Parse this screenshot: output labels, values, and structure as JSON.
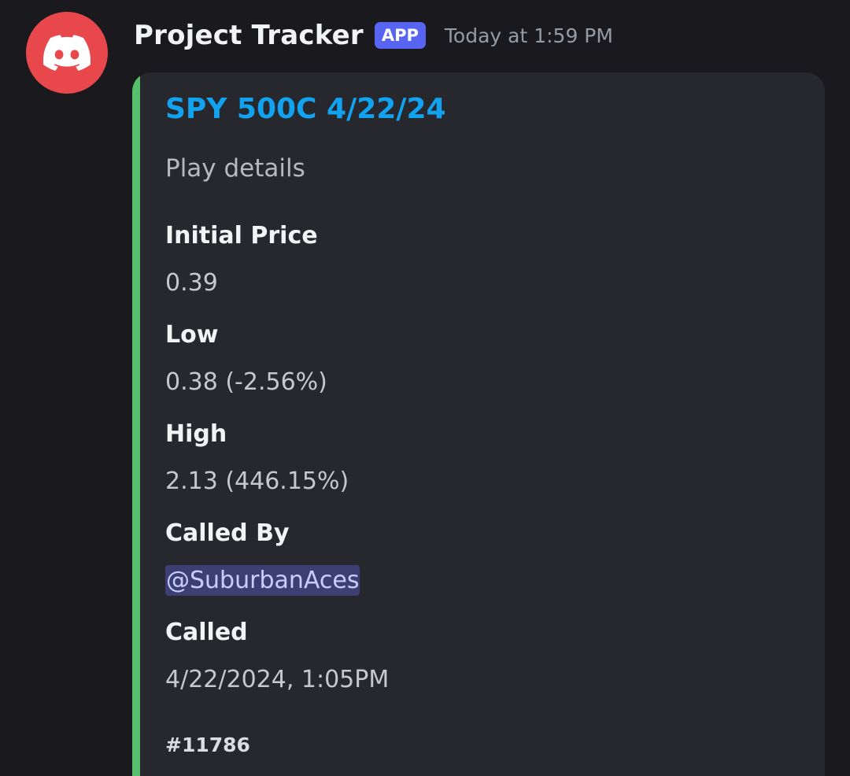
{
  "message": {
    "author": "Project Tracker",
    "badge": "APP",
    "timestamp": "Today at 1:59 PM",
    "avatar_icon": "discord-logo-icon",
    "colors": {
      "avatar_bg": "#e8474b",
      "badge_bg": "#5865f2",
      "embed_accent": "#57bf6b",
      "title": "#11a2f0",
      "mention_bg": "#3c3f74"
    }
  },
  "embed": {
    "title": "SPY 500C 4/22/24",
    "description": "Play details",
    "fields": [
      {
        "name": "Initial Price",
        "value": "0.39"
      },
      {
        "name": "Low",
        "value": "0.38 (-2.56%)"
      },
      {
        "name": "High",
        "value": "2.13 (446.15%)"
      },
      {
        "name": "Called By",
        "value": "@SuburbanAces"
      },
      {
        "name": "Called",
        "value": "4/22/2024, 1:05PM"
      }
    ],
    "footer": "#11786"
  }
}
